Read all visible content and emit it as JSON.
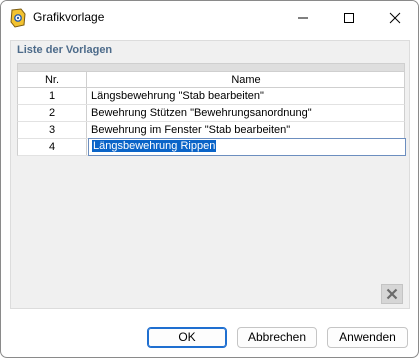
{
  "window": {
    "title": "Grafikvorlage"
  },
  "group": {
    "title": "Liste der Vorlagen"
  },
  "table": {
    "columns": [
      "Nr.",
      "Name"
    ],
    "rows": [
      {
        "nr": "1",
        "name": "Längsbewehrung \"Stab bearbeiten\""
      },
      {
        "nr": "2",
        "name": "Bewehrung Stützen \"Bewehrungsanordnung\""
      },
      {
        "nr": "3",
        "name": "Bewehrung im Fenster \"Stab bearbeiten\""
      },
      {
        "nr": "4",
        "name": "Längsbewehrung Rippen"
      }
    ]
  },
  "buttons": {
    "ok": "OK",
    "cancel": "Abbrechen",
    "apply": "Anwenden"
  },
  "colors": {
    "accent": "#0a64c8",
    "group_title": "#4d6b8a"
  }
}
